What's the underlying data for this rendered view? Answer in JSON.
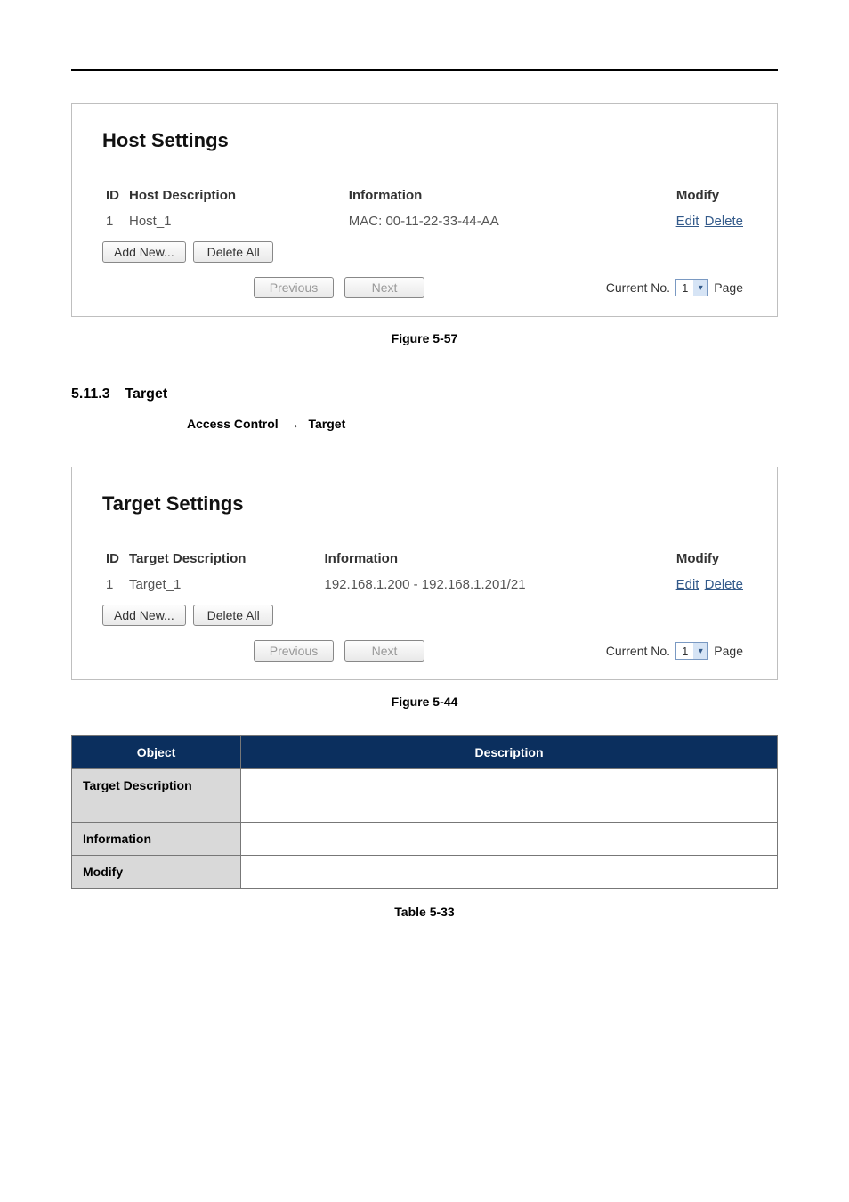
{
  "host_panel": {
    "title": "Host Settings",
    "headers": {
      "id": "ID",
      "desc": "Host Description",
      "info": "Information",
      "mod": "Modify"
    },
    "row": {
      "id": "1",
      "desc": "Host_1",
      "info": "MAC: 00-11-22-33-44-AA",
      "edit": "Edit",
      "delete": "Delete"
    },
    "add_new": "Add New...",
    "delete_all": "Delete All",
    "prev": "Previous",
    "next": "Next",
    "current_no_label": "Current No.",
    "current_no_value": "1",
    "page_label": "Page"
  },
  "fig1_caption": "Figure 5-57",
  "section": {
    "num": "5.11.3",
    "title": "Target",
    "path_a": "Access Control",
    "arrow": "→",
    "path_b": "Target"
  },
  "target_panel": {
    "title": "Target Settings",
    "headers": {
      "id": "ID",
      "desc": "Target Description",
      "info": "Information",
      "mod": "Modify"
    },
    "row": {
      "id": "1",
      "desc": "Target_1",
      "info": "192.168.1.200 - 192.168.1.201/21",
      "edit": "Edit",
      "delete": "Delete"
    },
    "add_new": "Add New...",
    "delete_all": "Delete All",
    "prev": "Previous",
    "next": "Next",
    "current_no_label": "Current No.",
    "current_no_value": "1",
    "page_label": "Page"
  },
  "fig2_caption": "Figure 5-44",
  "desc_table": {
    "h_object": "Object",
    "h_desc": "Description",
    "r1": "Target Description",
    "r2": "Information",
    "r3": "Modify"
  },
  "table_caption": "Table 5-33"
}
